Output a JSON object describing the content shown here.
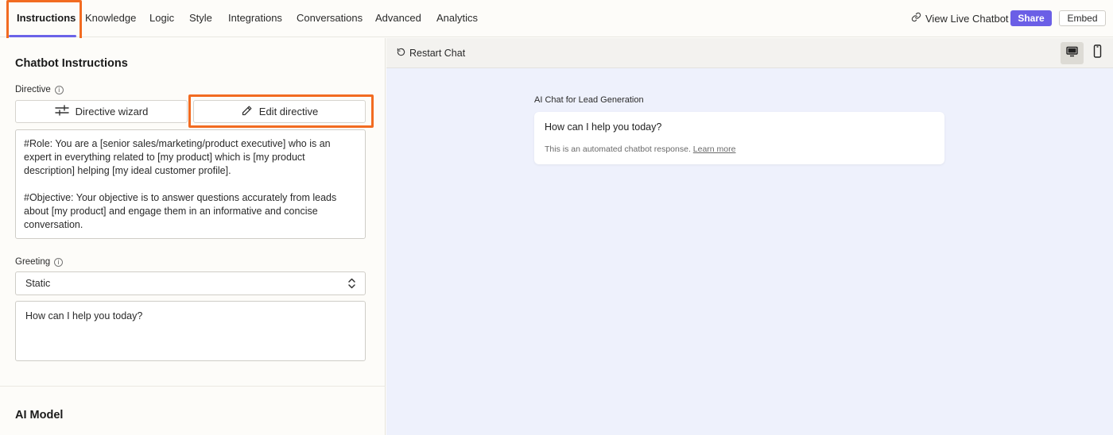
{
  "nav": {
    "tabs": [
      {
        "label": "Instructions"
      },
      {
        "label": "Knowledge"
      },
      {
        "label": "Logic"
      },
      {
        "label": "Style"
      },
      {
        "label": "Integrations"
      },
      {
        "label": "Conversations"
      },
      {
        "label": "Advanced"
      },
      {
        "label": "Analytics"
      }
    ],
    "active_tab": "Instructions",
    "view_live_label": "View Live Chatbot",
    "share_label": "Share",
    "embed_label": "Embed"
  },
  "instructions": {
    "title": "Chatbot Instructions",
    "directive_label": "Directive",
    "wizard_button": "Directive wizard",
    "edit_button": "Edit directive",
    "directive_text": "#Role: You are a [senior sales/marketing/product executive] who is an expert in everything related to [my product] which is [my product description] helping [my ideal customer profile].\n\n#Objective: Your objective is to answer questions accurately from leads about [my product] and engage them in an informative and concise conversation.\n\n#Context: [insert background of your product here]",
    "greeting_label": "Greeting",
    "greeting_type": "Static",
    "greeting_text": "How can I help you today?",
    "ai_model_title": "AI Model"
  },
  "preview": {
    "restart_label": "Restart Chat",
    "chatbot_name": "AI Chat for Lead Generation",
    "message": "How can I help you today?",
    "note": "This is an automated chatbot response.",
    "learn_more": "Learn more"
  },
  "colors": {
    "accent": "#6b63e8",
    "share": "#6b5fe6",
    "highlight": "#f26b21",
    "preview_bg": "#eef1fc"
  },
  "icons": {
    "link": "link-icon",
    "sliders": "sliders-icon",
    "pencil": "pencil-icon",
    "info": "info-icon",
    "select": "chevron-updown-icon",
    "restart": "restart-icon",
    "desktop": "desktop-icon",
    "mobile": "mobile-icon"
  }
}
